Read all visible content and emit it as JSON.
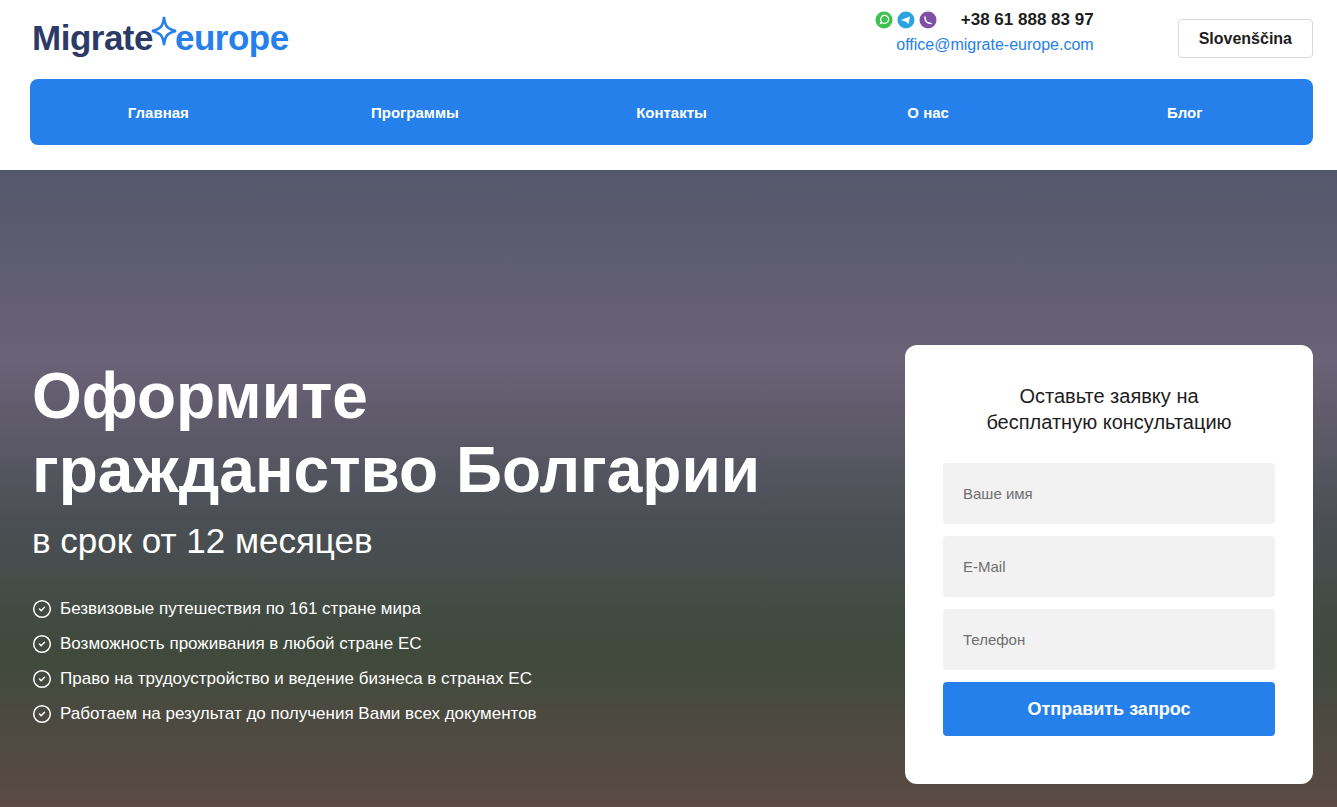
{
  "header": {
    "logo": {
      "first": "Migrate",
      "second": "europe"
    },
    "phone": "+38 61 888 83 97",
    "email": "office@migrate-europe.com",
    "language": "Slovenščina"
  },
  "nav": [
    {
      "label": "Главная"
    },
    {
      "label": "Программы"
    },
    {
      "label": "Контакты"
    },
    {
      "label": "О нас"
    },
    {
      "label": "Блог"
    }
  ],
  "hero": {
    "title_lines": [
      "Оформите",
      "гражданство Болгарии"
    ],
    "subtitle": "в срок от 12 месяцев",
    "benefits": [
      "Безвизовые путешествия по 161 стране мира",
      "Возможность проживания в любой стране ЕС",
      "Право на трудоустройство и ведение бизнеса в странах ЕС",
      "Работаем на результат до получения Вами всех документов"
    ]
  },
  "form": {
    "title_lines": [
      "Оставьте заявку на",
      "бесплатную консультацию"
    ],
    "fields": [
      {
        "placeholder": "Ваше имя"
      },
      {
        "placeholder": "E-Mail"
      },
      {
        "placeholder": "Телефон"
      }
    ],
    "submit": "Отправить запрос"
  }
}
